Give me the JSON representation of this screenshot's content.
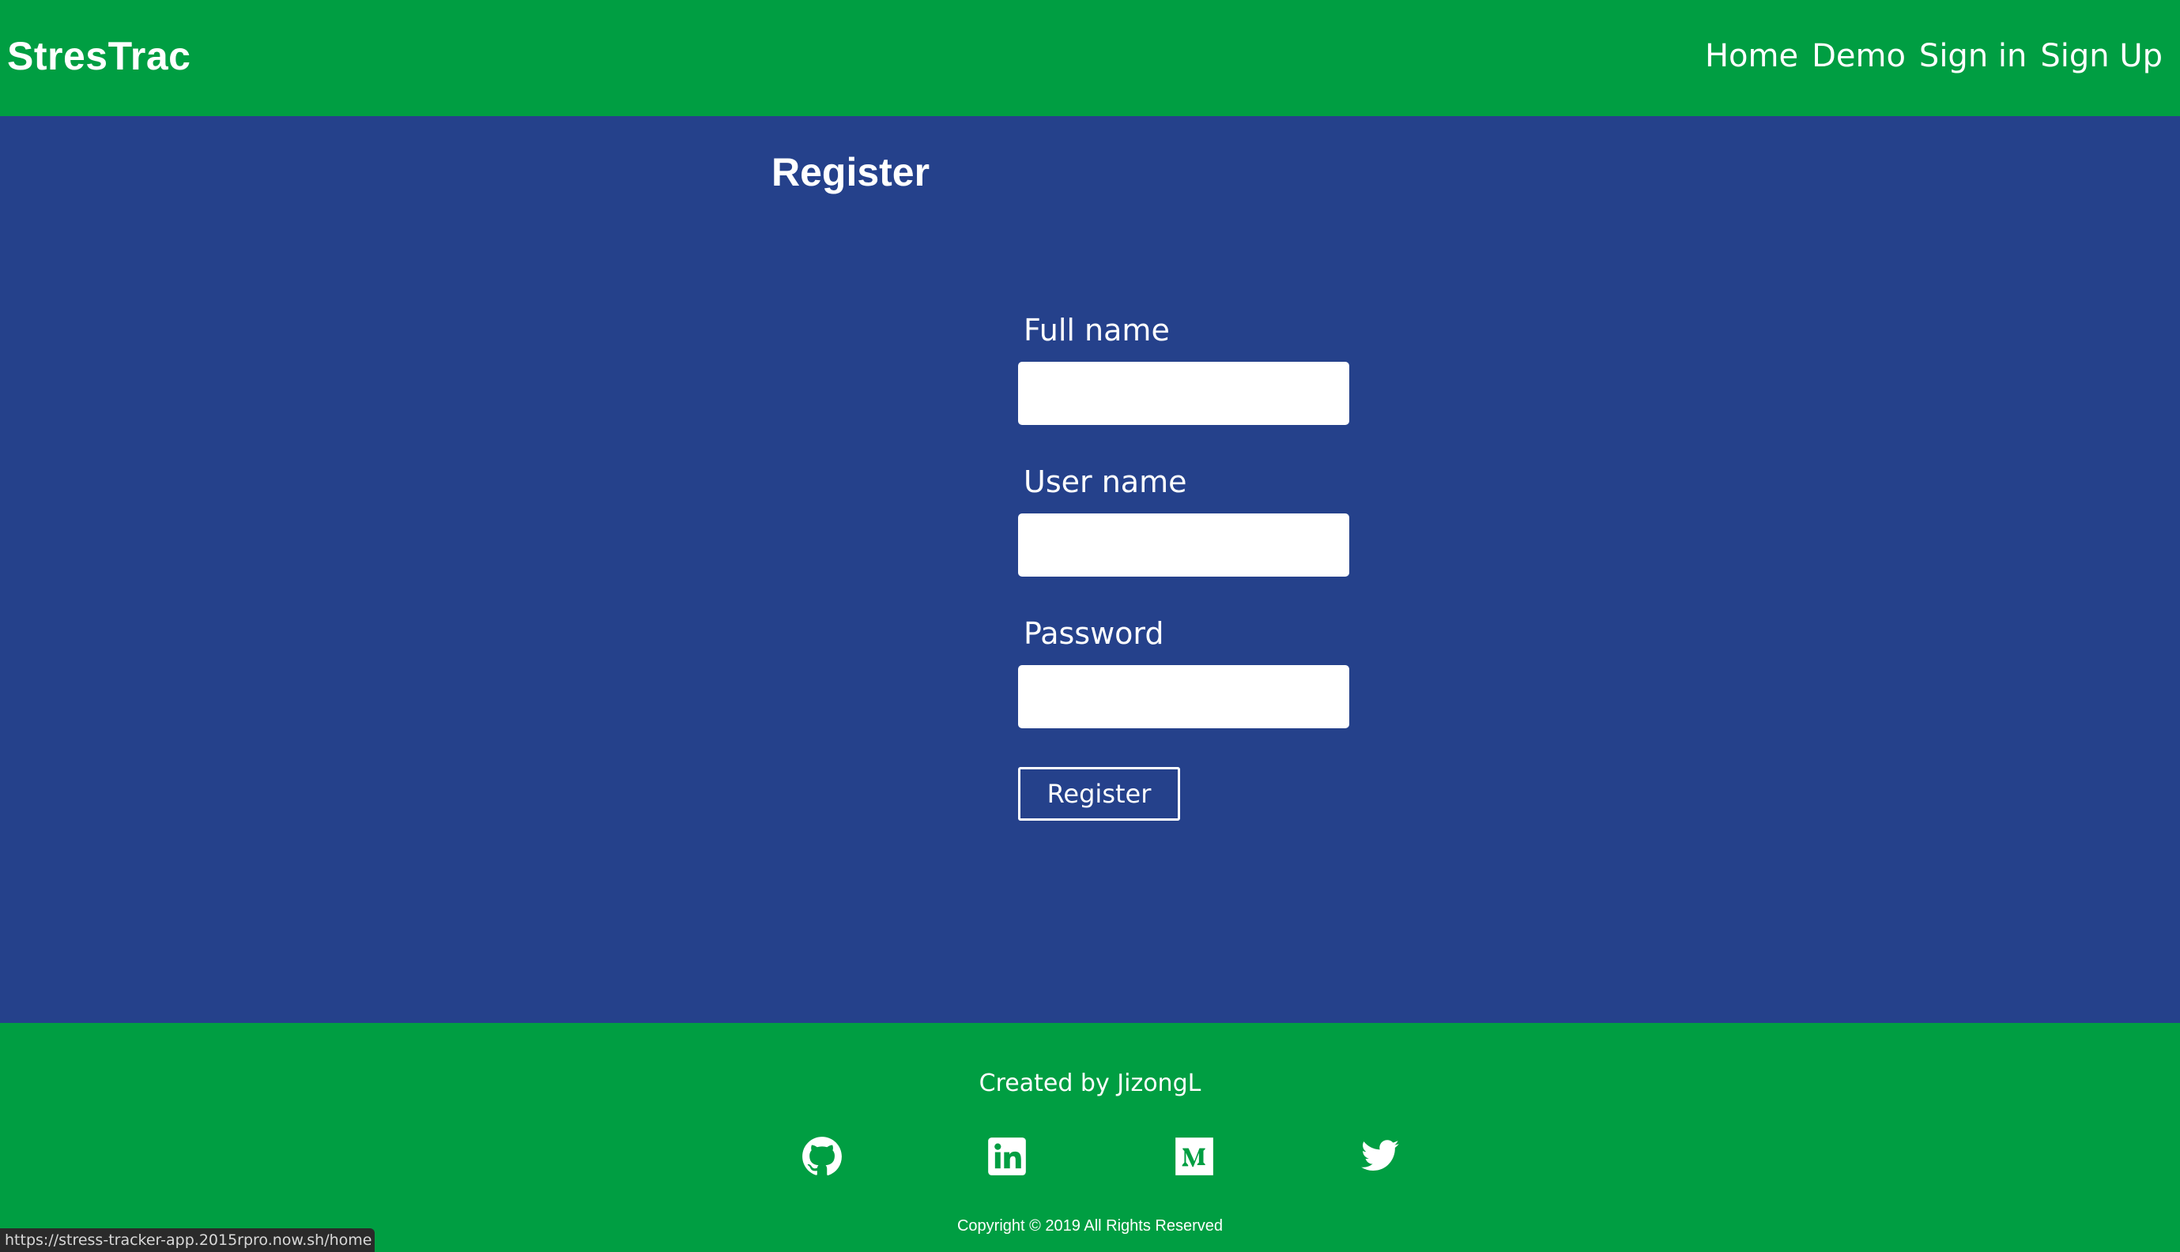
{
  "header": {
    "brand": "StresTrac",
    "nav": [
      {
        "label": "Home"
      },
      {
        "label": "Demo"
      },
      {
        "label": "Sign in"
      },
      {
        "label": "Sign Up"
      }
    ]
  },
  "main": {
    "title": "Register",
    "fields": [
      {
        "label": "Full name",
        "value": "",
        "placeholder": ""
      },
      {
        "label": "User name",
        "value": "",
        "placeholder": ""
      },
      {
        "label": "Password",
        "value": "",
        "placeholder": ""
      }
    ],
    "submit_label": "Register"
  },
  "footer": {
    "created_by": "Created by JizongL",
    "social_icons": [
      "github-icon",
      "linkedin-icon",
      "medium-icon",
      "twitter-icon"
    ],
    "copyright": "Copyright © 2019 All Rights Reserved"
  },
  "status_bar": {
    "url": "https://stress-tracker-app.2015rpro.now.sh/home"
  },
  "colors": {
    "header_bg": "#009E42",
    "main_bg": "#25418B",
    "text": "#FFFFFF"
  }
}
